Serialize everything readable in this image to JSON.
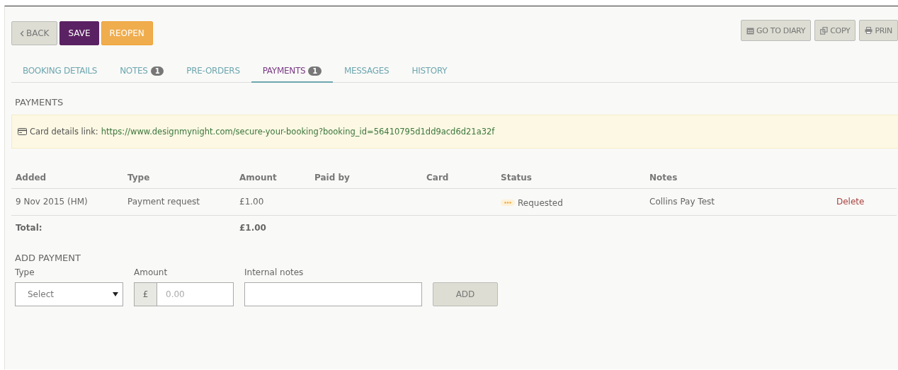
{
  "toolbar": {
    "left": [
      {
        "kind": "back",
        "label": "BACK"
      },
      {
        "kind": "primary",
        "label": "SAVE"
      },
      {
        "kind": "warning",
        "label": "REOPEN"
      }
    ],
    "right": [
      {
        "kind": "calendar",
        "label": "GO TO DIARY"
      },
      {
        "kind": "copy",
        "label": "COPY"
      },
      {
        "kind": "print",
        "label": "PRIN"
      }
    ]
  },
  "tabs": [
    {
      "label": "BOOKING DETAILS",
      "selected": false
    },
    {
      "label": "NOTES",
      "badge": "1",
      "selected": false
    },
    {
      "label": "PRE-ORDERS",
      "selected": false
    },
    {
      "label": "PAYMENTS",
      "badge": "1",
      "selected": true
    },
    {
      "label": "MESSAGES",
      "selected": false
    },
    {
      "label": "HISTORY",
      "selected": false
    }
  ],
  "payments": {
    "title": "PAYMENTS",
    "card_link": {
      "label": "Card details link:",
      "url": "https://www.designmynight.com/secure-your-booking?booking_id=56410795d1dd9acd6d21a32f"
    },
    "table": {
      "columns": [
        "Added",
        "Type",
        "Amount",
        "Paid by",
        "Card",
        "Status",
        "Notes"
      ],
      "rows": [
        {
          "added": "9 Nov 2015 (HM)",
          "type": "Payment request",
          "amount": "£1.00",
          "paid_by": "",
          "card": "",
          "status": "Requested",
          "notes": "Collins Pay Test",
          "action": "Delete"
        }
      ],
      "total": {
        "label": "Total:",
        "amount": "£1.00"
      }
    }
  },
  "add_payment": {
    "title": "ADD PAYMENT",
    "type": {
      "label": "Type",
      "value": "Select"
    },
    "amount": {
      "label": "Amount",
      "prefix": "£",
      "placeholder": "0.00"
    },
    "notes": {
      "label": "Internal notes"
    },
    "button": "ADD"
  }
}
